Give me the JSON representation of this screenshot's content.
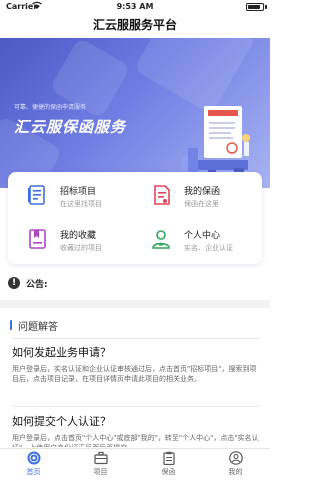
{
  "status_bar": {
    "carrier": "Carrier",
    "time": "9:53 AM"
  },
  "header": {
    "title": "汇云服服务平台"
  },
  "banner": {
    "slogan": "可靠、便捷的保函申请服务",
    "brand": "汇云服保函服务"
  },
  "menu": [
    {
      "title": "招标项目",
      "subtitle": "在这里找项目",
      "icon": "document-list-icon",
      "color": "#3d6fe0"
    },
    {
      "title": "我的保函",
      "subtitle": "保函在这里",
      "icon": "contract-icon",
      "color": "#e2455b"
    },
    {
      "title": "我的收藏",
      "subtitle": "收藏过的项目",
      "icon": "bookmark-icon",
      "color": "#b046c6"
    },
    {
      "title": "个人中心",
      "subtitle": "实名、企业认证",
      "icon": "user-icon",
      "color": "#2ea45b"
    }
  ],
  "notice": {
    "label": "公告:"
  },
  "faq_section": {
    "title": "问题解答"
  },
  "faq": [
    {
      "q": "如何发起业务申请？",
      "a": "用户登录后，实名认证和企业认证审核通过后，点击首页\"招标项目\"，搜索到项目后，点击项目记录，在项目详情页申请此项目的相关业务。"
    },
    {
      "q": "如何提交个人认证？",
      "a": "用户登录后，点击首页\"个人中心\"或底部\"我的\"，转至\"个人中心\"，点击\"实名认证\"，上传用户身份证正反面后再提交。"
    }
  ],
  "tabbar": [
    {
      "label": "首页",
      "icon": "home-icon",
      "active": true
    },
    {
      "label": "项目",
      "icon": "briefcase-icon",
      "active": false
    },
    {
      "label": "保函",
      "icon": "clipboard-icon",
      "active": false
    },
    {
      "label": "我的",
      "icon": "profile-icon",
      "active": false
    }
  ],
  "colors": {
    "accent": "#3d6fe0",
    "banner_start": "#4b58c6",
    "banner_end": "#a8b4f2"
  }
}
